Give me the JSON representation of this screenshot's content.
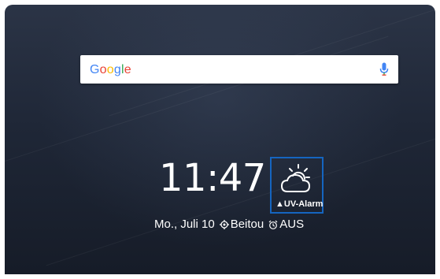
{
  "search": {
    "logo_letters": [
      {
        "ch": "G",
        "color": "#4285f4"
      },
      {
        "ch": "o",
        "color": "#ea4335"
      },
      {
        "ch": "o",
        "color": "#fbbc05"
      },
      {
        "ch": "g",
        "color": "#4285f4"
      },
      {
        "ch": "l",
        "color": "#34a853"
      },
      {
        "ch": "e",
        "color": "#ea4335"
      }
    ],
    "mic_icon": "mic-icon"
  },
  "clock": {
    "time": "11:47"
  },
  "weather": {
    "icon": "partly-cloudy-icon",
    "alarm": "UV-Alarm",
    "alarm_icon": "warning-triangle-icon",
    "highlight_color": "#1565c0"
  },
  "info": {
    "date": "Mo., Juli 10",
    "location_icon": "location-icon",
    "location": "Beitou",
    "alarm_icon": "alarm-clock-icon",
    "alarm_state": "AUS"
  }
}
